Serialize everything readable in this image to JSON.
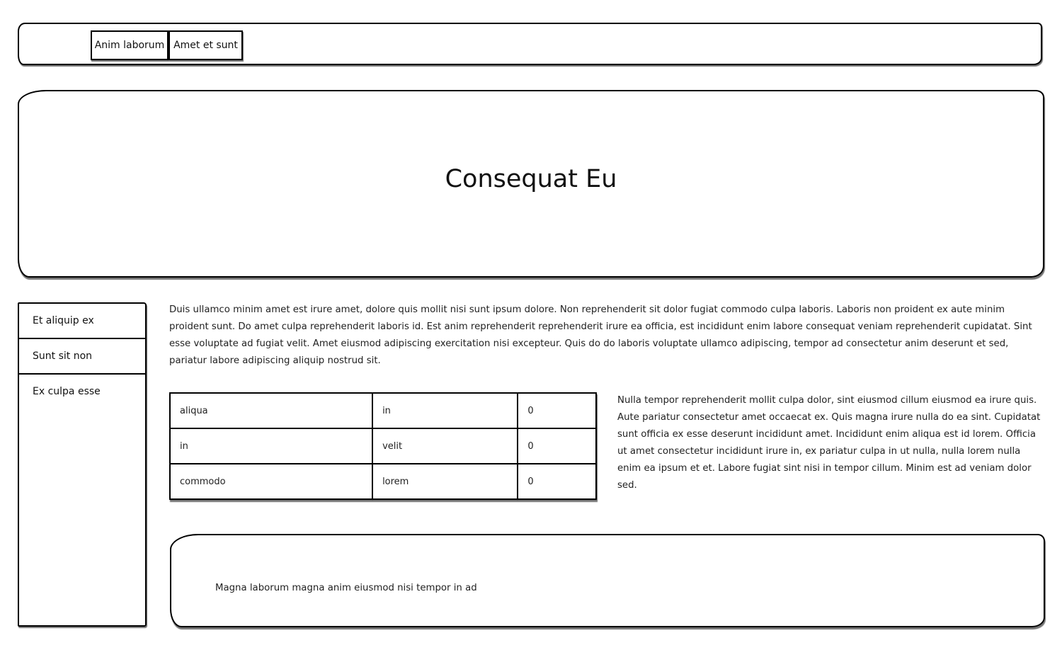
{
  "nav": {
    "items": [
      {
        "label": "Anim laborum"
      },
      {
        "label": "Amet et sunt"
      }
    ]
  },
  "hero": {
    "title": "Consequat Eu"
  },
  "sidebar": {
    "items": [
      {
        "label": "Et aliquip ex"
      },
      {
        "label": "Sunt sit non"
      },
      {
        "label": "Ex culpa esse"
      }
    ]
  },
  "main": {
    "paragraph_1": "Duis ullamco minim amet est irure amet, dolore quis mollit nisi sunt ipsum dolore. Non reprehenderit sit dolor fugiat commodo culpa laboris. Laboris non proident ex aute minim proident sunt. Do amet culpa reprehenderit laboris id. Est anim reprehenderit reprehenderit irure ea officia, est incididunt enim labore consequat veniam reprehenderit cupidatat. Sint esse voluptate ad fugiat velit. Amet eiusmod adipiscing exercitation nisi excepteur. Quis do do laboris voluptate ullamco adipiscing, tempor ad consectetur anim deserunt et sed, pariatur labore adipiscing aliquip nostrud sit.",
    "table": {
      "rows": [
        [
          "aliqua",
          "in",
          "0"
        ],
        [
          "in",
          "velit",
          "0"
        ],
        [
          "commodo",
          "lorem",
          "0"
        ]
      ]
    },
    "paragraph_2": "Nulla tempor reprehenderit mollit culpa dolor, sint eiusmod cillum eiusmod ea irure quis. Aute pariatur consectetur amet occaecat ex. Quis magna irure nulla do ea sint. Cupidatat sunt officia ex esse deserunt incididunt amet. Incididunt enim aliqua est id lorem. Officia ut amet consectetur incididunt irure in, ex pariatur culpa in ut nulla, nulla lorem nulla enim ea ipsum et et. Labore fugiat sint nisi in tempor cillum. Minim est ad veniam dolor sed.",
    "footer_text": "Magna laborum magna anim eiusmod nisi tempor in ad"
  }
}
